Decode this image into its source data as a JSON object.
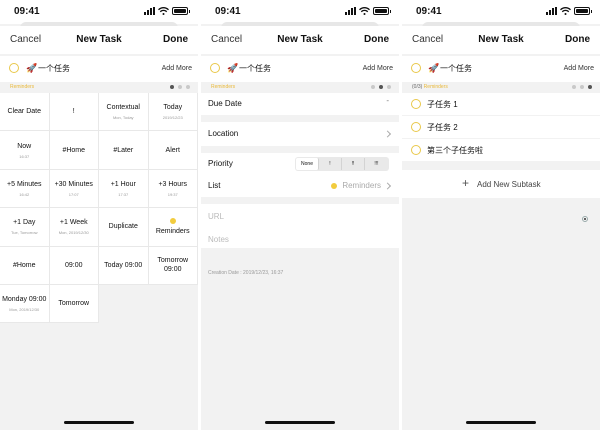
{
  "status": {
    "time": "09:41"
  },
  "nav": {
    "cancel": "Cancel",
    "title": "New Task",
    "done": "Done"
  },
  "task": {
    "emoji": "🚀",
    "title": "一个任务",
    "add_more": "Add More"
  },
  "list_tag": "Reminders",
  "subtask_count": "(0/3)",
  "quick_grid": [
    {
      "label": "Clear Date",
      "sub": ""
    },
    {
      "label": "!",
      "sub": ""
    },
    {
      "label": "Contextual",
      "sub": "Mon, Today"
    },
    {
      "label": "Today",
      "sub": "2019/12/23"
    },
    {
      "label": "Now",
      "sub": "16:37"
    },
    {
      "label": "#Home",
      "sub": ""
    },
    {
      "label": "#Later",
      "sub": ""
    },
    {
      "label": "Alert",
      "sub": ""
    },
    {
      "label": "+5 Minutes",
      "sub": "16:42"
    },
    {
      "label": "+30 Minutes",
      "sub": "17:07"
    },
    {
      "label": "+1 Hour",
      "sub": "17:37"
    },
    {
      "label": "+3 Hours",
      "sub": "19:37"
    },
    {
      "label": "+1 Day",
      "sub": "Tue, Tomorrow"
    },
    {
      "label": "+1 Week",
      "sub": "Mon, 2019/12/30"
    },
    {
      "label": "Duplicate",
      "sub": ""
    },
    {
      "label": "Reminders",
      "sub": ""
    },
    {
      "label": "#Home",
      "sub": ""
    },
    {
      "label": "09:00",
      "sub": ""
    },
    {
      "label": "Today 09:00",
      "sub": ""
    },
    {
      "label": "Tomorrow 09:00",
      "sub": ""
    },
    {
      "label": "Monday 09:00",
      "sub": "Mon, 2019/12/30"
    },
    {
      "label": "Tomorrow",
      "sub": ""
    }
  ],
  "detail": {
    "due_date": "Due Date",
    "due_dash": "-",
    "location": "Location",
    "priority": "Priority",
    "priority_options": [
      "None",
      "!",
      "!!",
      "!!!"
    ],
    "priority_selected": "None",
    "list": "List",
    "list_value": "Reminders",
    "url_placeholder": "URL",
    "notes_placeholder": "Notes",
    "creation_date": "Creation Date : 2019/12/23, 16:37"
  },
  "subtasks": [
    "子任务 1",
    "子任务 2",
    "第三个子任务啦"
  ],
  "add_subtask": "Add New Subtask",
  "colors": {
    "accent_yellow": "#f2cc3e",
    "list_tag": "#e9b93a",
    "background": "#f2f2f2"
  },
  "icons": [
    "signal-icon",
    "wifi-icon",
    "battery-icon",
    "rocket-icon",
    "chevron-right-icon",
    "plus-icon",
    "page-dots-indicator"
  ]
}
